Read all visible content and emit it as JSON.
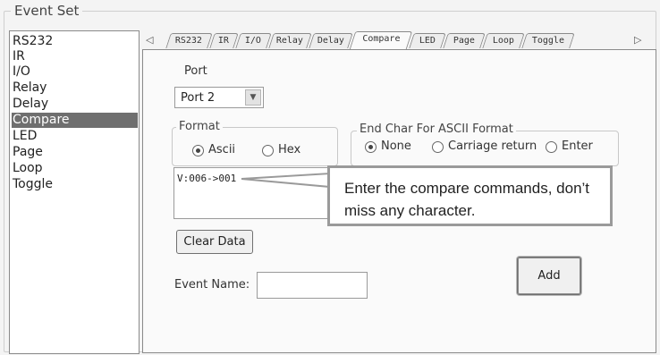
{
  "group_title": "Event Set",
  "event_list": {
    "items": [
      "RS232",
      "IR",
      "I/O",
      "Relay",
      "Delay",
      "Compare",
      "LED",
      "Page",
      "Loop",
      "Toggle"
    ],
    "selected": "Compare"
  },
  "tabs": {
    "items": [
      "RS232",
      "IR",
      "I/O",
      "Relay",
      "Delay",
      "Compare",
      "LED",
      "Page",
      "Loop",
      "Toggle"
    ],
    "active": "Compare",
    "left_arrow": "◁",
    "right_arrow": "▷"
  },
  "port": {
    "label": "Port",
    "value": "Port 2"
  },
  "format": {
    "title": "Format",
    "options": [
      "Ascii",
      "Hex"
    ],
    "selected": "Ascii"
  },
  "end_char": {
    "title": "End Char For ASCII Format",
    "options": [
      "None",
      "Carriage return",
      "Enter"
    ],
    "selected": "None"
  },
  "data_text": "V:006->001",
  "callout": "Enter the compare commands, don’t miss any character.",
  "clear_button": "Clear Data",
  "event_name": {
    "label": "Event Name:",
    "value": ""
  },
  "add_button": "Add"
}
